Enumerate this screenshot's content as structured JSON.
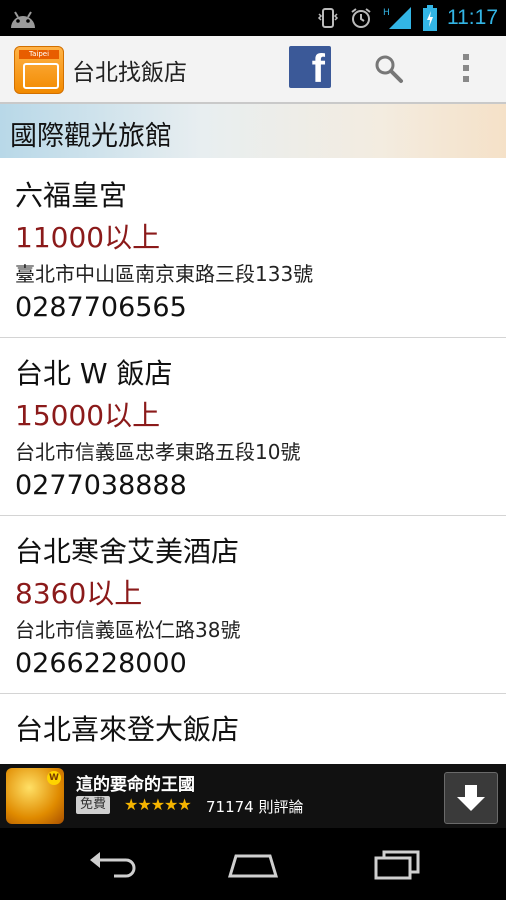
{
  "status_bar": {
    "time": "11:17",
    "network_label": "H"
  },
  "action_bar": {
    "app_title": "台北找飯店",
    "app_icon_tag": "Taipei",
    "facebook_letter": "f"
  },
  "section": {
    "title": "國際觀光旅館"
  },
  "hotels": [
    {
      "name": "六福皇宮",
      "price": "11000以上",
      "address": "臺北市中山區南京東路三段133號",
      "phone": "0287706565"
    },
    {
      "name": "台北 W 飯店",
      "price": "15000以上",
      "address": "台北市信義區忠孝東路五段10號",
      "phone": "0277038888"
    },
    {
      "name": "台北寒舍艾美酒店",
      "price": "8360以上",
      "address": "台北市信義區松仁路38號",
      "phone": "0266228000"
    },
    {
      "name": "台北喜來登大飯店",
      "price": "",
      "address": "",
      "phone": ""
    }
  ],
  "ad": {
    "title": "這的要命的王國",
    "free_label": "免費",
    "stars_text": "★★★★★",
    "rating": 4.5,
    "reviews": "71174 則評論",
    "icon_badge": "W"
  },
  "colors": {
    "accent": "#33b5e5",
    "price": "#8b1a1a",
    "facebook": "#3b5998"
  }
}
